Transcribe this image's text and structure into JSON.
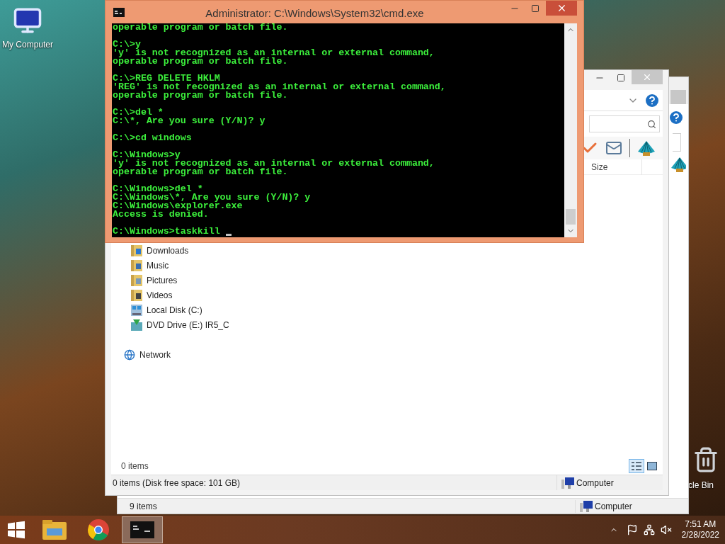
{
  "desktop": {
    "icons": [
      {
        "label": "My Computer",
        "kind": "computer"
      },
      {
        "label": "cle Bin",
        "kind": "recycle"
      }
    ]
  },
  "back_window": {
    "status_left": "9 items",
    "status_right": "Computer"
  },
  "explorer": {
    "column_header": "Size",
    "nav_items": [
      {
        "label": "Downloads",
        "kind": "downloads"
      },
      {
        "label": "Music",
        "kind": "music"
      },
      {
        "label": "Pictures",
        "kind": "pictures"
      },
      {
        "label": "Videos",
        "kind": "videos"
      },
      {
        "label": "Local Disk (C:)",
        "kind": "disk"
      },
      {
        "label": "DVD Drive (E:) IR5_C",
        "kind": "dvd"
      }
    ],
    "network": "Network",
    "item_count": "0 items",
    "view_buttons": [
      {
        "kind": "details",
        "selected": true
      },
      {
        "kind": "thumbnails",
        "selected": false
      }
    ],
    "status_left": "0 items (Disk free space: 101 GB)",
    "status_right": "Computer"
  },
  "cmd": {
    "title": "Administrator: C:\\Windows\\System32\\cmd.exe",
    "blocks": [
      [
        "operable program or batch file."
      ],
      [
        "C:\\>y",
        "'y' is not recognized as an internal or external command,",
        "operable program or batch file."
      ],
      [
        "C:\\>REG DELETE HKLM",
        "'REG' is not recognized as an internal or external command,",
        "operable program or batch file."
      ],
      [
        "C:\\>del *",
        "C:\\*, Are you sure (Y/N)? y"
      ],
      [
        "C:\\>cd windows"
      ],
      [
        "C:\\Windows>y",
        "'y' is not recognized as an internal or external command,",
        "operable program or batch file."
      ],
      [
        "C:\\Windows>del *",
        "C:\\Windows\\*, Are you sure (Y/N)? y",
        "C:\\Windows\\explorer.exe",
        "Access is denied."
      ],
      [
        "C:\\Windows>taskkill"
      ]
    ]
  },
  "taskbar": {
    "apps": [
      {
        "kind": "explorer",
        "active": false
      },
      {
        "kind": "chrome",
        "active": false
      },
      {
        "kind": "cmd",
        "active": true
      }
    ],
    "time": "7:51 AM",
    "date": "2/28/2022"
  }
}
